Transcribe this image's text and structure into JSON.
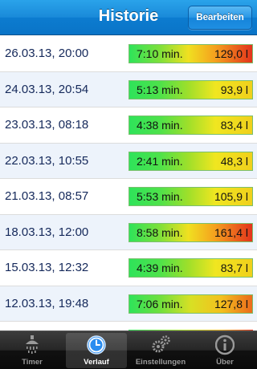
{
  "header": {
    "title": "Historie",
    "edit_label": "Bearbeiten"
  },
  "history": [
    {
      "date": "26.03.13, 20:00",
      "duration": "7:10 min.",
      "volume": "129,0 l",
      "level": "high"
    },
    {
      "date": "24.03.13, 20:54",
      "duration": "5:13 min.",
      "volume": "93,9 l",
      "level": "low"
    },
    {
      "date": "23.03.13, 08:18",
      "duration": "4:38 min.",
      "volume": "83,4 l",
      "level": "low"
    },
    {
      "date": "22.03.13, 10:55",
      "duration": "2:41 min.",
      "volume": "48,3 l",
      "level": "low"
    },
    {
      "date": "21.03.13, 08:57",
      "duration": "5:53 min.",
      "volume": "105,9 l",
      "level": "low"
    },
    {
      "date": "18.03.13, 12:00",
      "duration": "8:58 min.",
      "volume": "161,4 l",
      "level": "high"
    },
    {
      "date": "15.03.13, 12:32",
      "duration": "4:39 min.",
      "volume": "83,7 l",
      "level": "low"
    },
    {
      "date": "12.03.13, 19:48",
      "duration": "7:06 min.",
      "volume": "127,8 l",
      "level": "mid"
    }
  ],
  "tabs": [
    {
      "label": "Timer",
      "icon": "shower-icon"
    },
    {
      "label": "Verlauf",
      "icon": "clock-icon"
    },
    {
      "label": "Einstellungen",
      "icon": "gears-icon"
    },
    {
      "label": "Über",
      "icon": "info-icon"
    }
  ],
  "active_tab": "Verlauf",
  "colors": {
    "nav_blue": "#1a8ad9",
    "bar_green": "#2fe35a",
    "bar_yellow": "#f0e620",
    "bar_red": "#e3331c",
    "date_text": "#14285a"
  }
}
